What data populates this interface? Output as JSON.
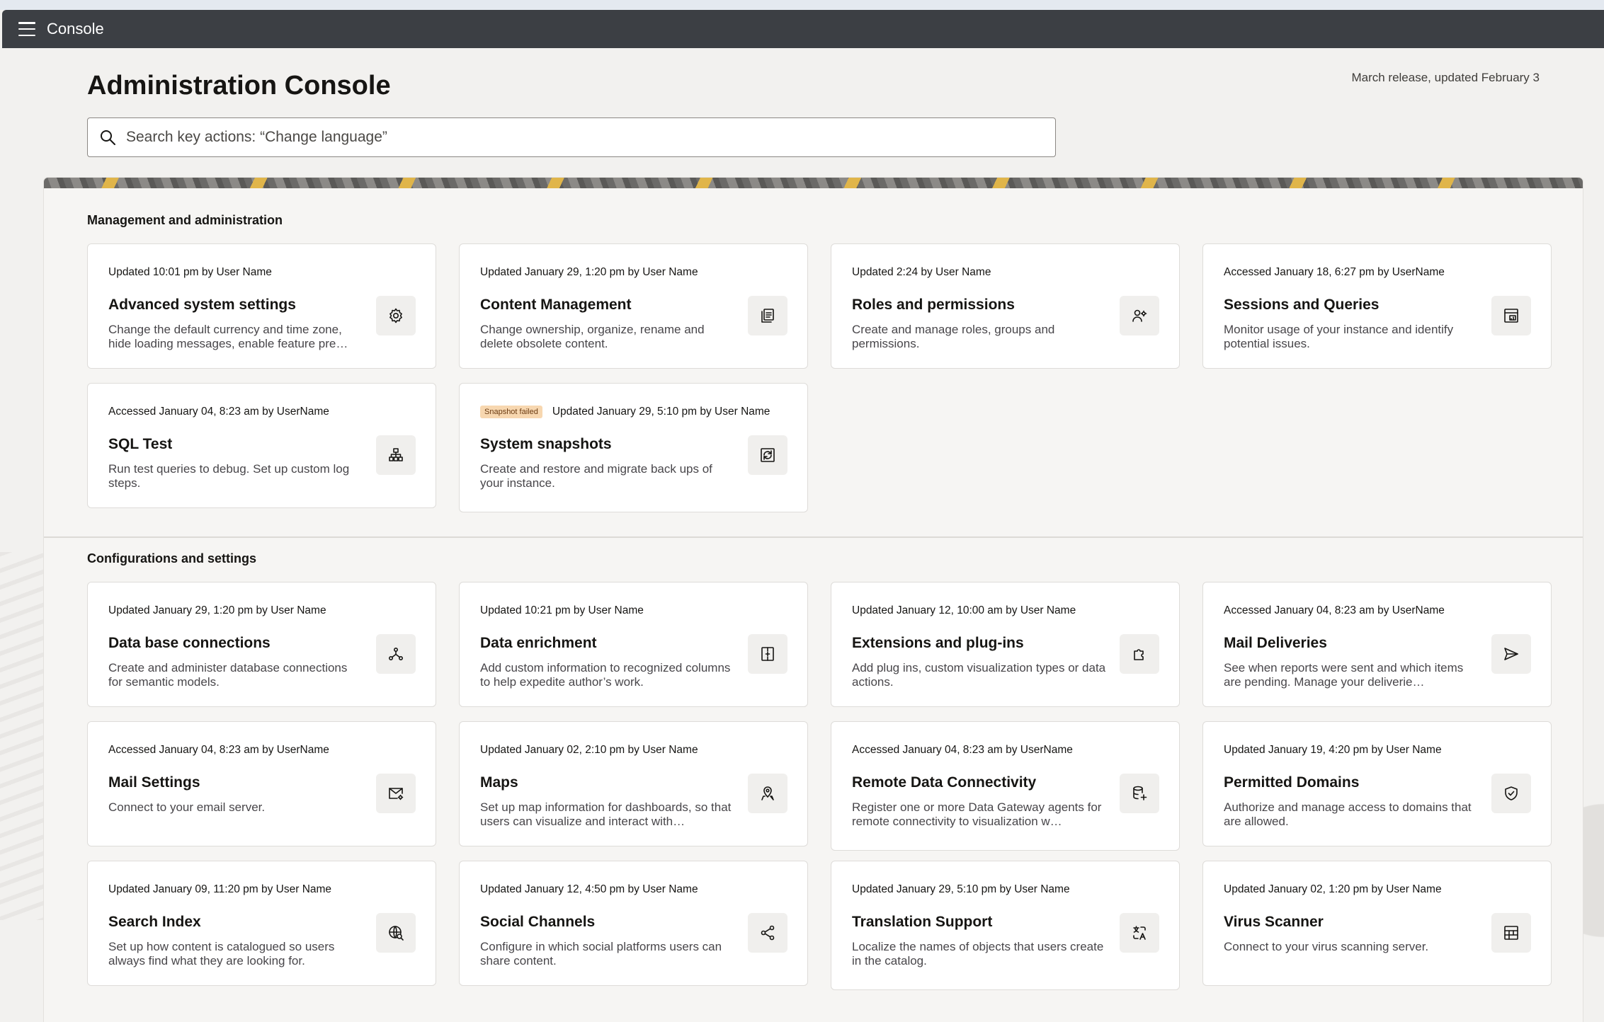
{
  "app": {
    "title": "Console"
  },
  "page": {
    "title": "Administration Console",
    "release_note": "March release, updated February 3"
  },
  "search": {
    "placeholder": "Search key actions: “Change language”"
  },
  "sections": [
    {
      "title": "Management and administration",
      "cards": [
        {
          "meta": "Updated 10:01 pm by User Name",
          "title": "Advanced system settings",
          "desc": "Change the default currency and time zone, hide loading messages, enable feature pre…",
          "icon": "gear-icon"
        },
        {
          "meta": "Updated January 29, 1:20 pm by User Name",
          "title": "Content Management",
          "desc": "Change ownership, organize, rename and delete obsolete content.",
          "icon": "documents-icon"
        },
        {
          "meta": "Updated 2:24 by User Name",
          "title": "Roles and permissions",
          "desc": "Create and manage roles, groups and permissions.",
          "icon": "user-settings-icon"
        },
        {
          "meta": "Accessed January 18, 6:27 pm by UserName",
          "title": "Sessions and Queries",
          "desc": "Monitor usage of your instance and identify potential issues.",
          "icon": "monitor-report-icon"
        },
        {
          "meta": "Accessed January 04, 8:23 am by UserName",
          "title": "SQL Test",
          "desc": "Run test queries to debug. Set up custom log steps.",
          "icon": "hierarchy-icon"
        },
        {
          "badge": "Snapshot failed",
          "meta": "Updated January 29, 5:10 pm by User Name",
          "title": "System snapshots",
          "desc": "Create and restore and migrate back ups of your instance.",
          "icon": "snapshot-icon"
        }
      ]
    },
    {
      "title": "Configurations and settings",
      "cards": [
        {
          "meta": "Updated January 29, 1:20 pm by User Name",
          "title": "Data base connections",
          "desc": "Create and administer database connections for semantic models.",
          "icon": "connections-icon"
        },
        {
          "meta": "Updated 10:21 pm by User Name",
          "title": "Data enrichment",
          "desc": "Add custom information to recognized columns to help expedite author’s work.",
          "icon": "enrich-icon"
        },
        {
          "meta": "Updated January 12, 10:00 am by User Name",
          "title": "Extensions and plug-ins",
          "desc": "Add plug ins, custom visualization types or data actions.",
          "icon": "puzzle-icon"
        },
        {
          "meta": "Accessed January 04, 8:23 am by UserName",
          "title": "Mail Deliveries",
          "desc": "See when reports were sent and which items are pending. Manage your deliverie…",
          "icon": "send-icon"
        },
        {
          "meta": "Accessed January 04, 8:23 am by UserName",
          "title": "Mail Settings",
          "desc": "Connect to your email server.",
          "icon": "mail-settings-icon"
        },
        {
          "meta": "Updated January 02, 2:10 pm by User Name",
          "title": "Maps",
          "desc": "Set up map information for dashboards, so that users can visualize and interact with…",
          "icon": "map-pin-icon"
        },
        {
          "meta": "Accessed January 04, 8:23 am by UserName",
          "title": "Remote Data Connectivity",
          "desc": "Register one or more Data Gateway agents for remote connectivity to visualization w…",
          "icon": "database-add-icon"
        },
        {
          "meta": "Updated January 19, 4:20 pm by User Name",
          "title": "Permitted Domains",
          "desc": "Authorize and manage access to domains that are allowed.",
          "icon": "shield-check-icon"
        },
        {
          "meta": "Updated January 09, 11:20 pm by User Name",
          "title": "Search Index",
          "desc": "Set up how content is catalogued so users always find what they are looking for.",
          "icon": "globe-search-icon"
        },
        {
          "meta": "Updated January 12, 4:50 pm by User Name",
          "title": "Social Channels",
          "desc": "Configure in which social platforms users can share content.",
          "icon": "share-icon"
        },
        {
          "meta": "Updated January 29, 5:10 pm by User Name",
          "title": "Translation Support",
          "desc": "Localize the names of objects that users create in the catalog.",
          "icon": "translate-icon"
        },
        {
          "meta": "Updated January 02, 1:20 pm by User Name",
          "title": "Virus Scanner",
          "desc": "Connect to your virus scanning server.",
          "icon": "scanner-grid-icon"
        }
      ]
    }
  ]
}
